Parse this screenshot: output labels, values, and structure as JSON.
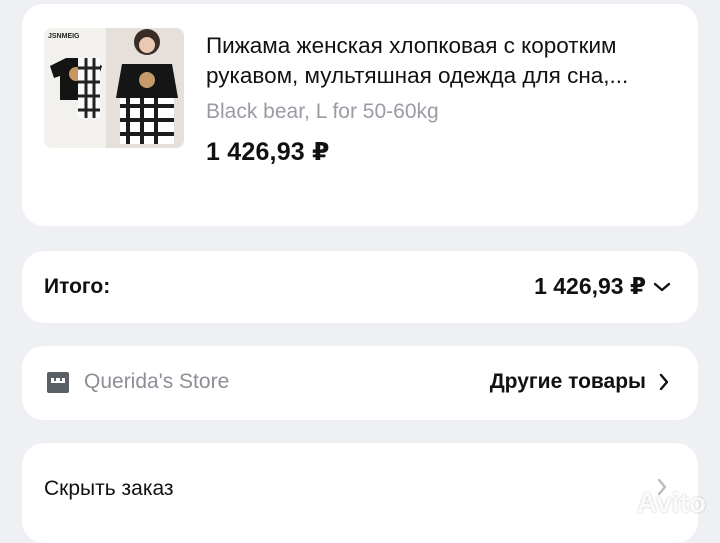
{
  "product": {
    "title_line1": "Пижама женская хлопковая с коротким",
    "title_line2": "рукавом, мультяшная одежда для сна,...",
    "variant": "Black bear, L for 50-60kg",
    "price": "1 426,93 ₽",
    "image_icon": "pajama-product-photo",
    "image_brand_text": "JSNMEIG"
  },
  "total": {
    "label": "Итого:",
    "amount": "1 426,93 ₽",
    "toggle_icon": "chevron-down-icon"
  },
  "store": {
    "icon": "store-icon",
    "name": "Querida's Store",
    "link_label": "Другие товары",
    "link_icon": "chevron-right-icon"
  },
  "hide_order": {
    "label": "Скрыть заказ",
    "icon": "chevron-right-icon"
  },
  "watermark": {
    "text": "Avito"
  },
  "colors": {
    "background": "#eef0f3",
    "card": "#ffffff",
    "muted_text": "#9a9ca3",
    "primary_text": "#111111"
  }
}
